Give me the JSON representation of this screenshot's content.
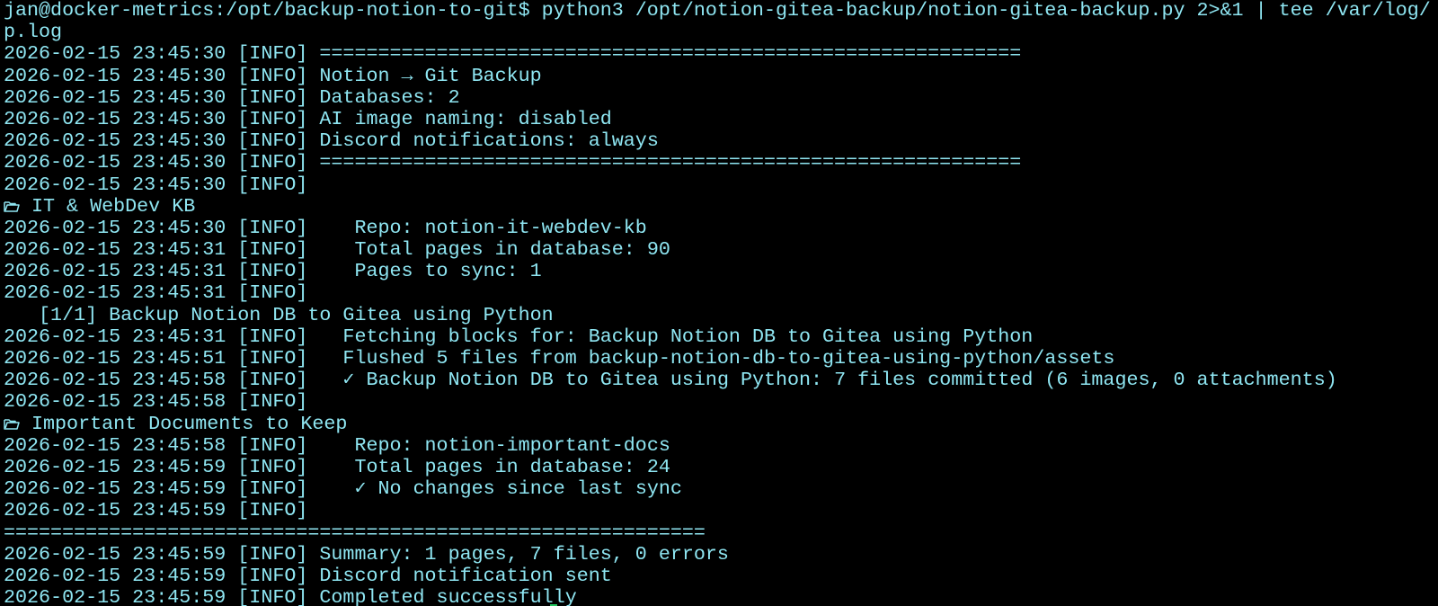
{
  "terminal": {
    "prompt_line": "jan@docker-metrics:/opt/backup-notion-to-git$ python3 /opt/notion-gitea-backup/notion-gitea-backup.py 2>&1 | tee /var/log/",
    "prompt_wrap": "p.log",
    "colors": {
      "background": "#000000",
      "text": "#8fe6f2",
      "cursor": "#22c55e"
    },
    "log": [
      {
        "ts": "2026-02-15 23:45:30",
        "level": "[INFO]",
        "msg": " ============================================================"
      },
      {
        "ts": "2026-02-15 23:45:30",
        "level": "[INFO]",
        "msg": " Notion → Git Backup"
      },
      {
        "ts": "2026-02-15 23:45:30",
        "level": "[INFO]",
        "msg": " Databases: 2"
      },
      {
        "ts": "2026-02-15 23:45:30",
        "level": "[INFO]",
        "msg": " AI image naming: disabled"
      },
      {
        "ts": "2026-02-15 23:45:30",
        "level": "[INFO]",
        "msg": " Discord notifications: always"
      },
      {
        "ts": "2026-02-15 23:45:30",
        "level": "[INFO]",
        "msg": " ============================================================"
      },
      {
        "ts": "2026-02-15 23:45:30",
        "level": "[INFO]",
        "msg": ""
      }
    ],
    "db1": {
      "icon": "folder-icon",
      "title": " IT & WebDev KB",
      "log": [
        {
          "ts": "2026-02-15 23:45:30",
          "level": "[INFO]",
          "msg": "    Repo: notion-it-webdev-kb"
        },
        {
          "ts": "2026-02-15 23:45:31",
          "level": "[INFO]",
          "msg": "    Total pages in database: 90"
        },
        {
          "ts": "2026-02-15 23:45:31",
          "level": "[INFO]",
          "msg": "    Pages to sync: 1"
        },
        {
          "ts": "2026-02-15 23:45:31",
          "level": "[INFO]",
          "msg": ""
        }
      ],
      "page_header": "   [1/1] Backup Notion DB to Gitea using Python",
      "page_log": [
        {
          "ts": "2026-02-15 23:45:31",
          "level": "[INFO]",
          "msg": "   Fetching blocks for: Backup Notion DB to Gitea using Python"
        },
        {
          "ts": "2026-02-15 23:45:51",
          "level": "[INFO]",
          "msg": "   Flushed 5 files from backup-notion-db-to-gitea-using-python/assets"
        },
        {
          "ts": "2026-02-15 23:45:58",
          "level": "[INFO]",
          "msg": "   ✓ Backup Notion DB to Gitea using Python: 7 files committed (6 images, 0 attachments)"
        },
        {
          "ts": "2026-02-15 23:45:58",
          "level": "[INFO]",
          "msg": ""
        }
      ]
    },
    "db2": {
      "icon": "folder-icon",
      "title": " Important Documents to Keep",
      "log": [
        {
          "ts": "2026-02-15 23:45:58",
          "level": "[INFO]",
          "msg": "    Repo: notion-important-docs"
        },
        {
          "ts": "2026-02-15 23:45:59",
          "level": "[INFO]",
          "msg": "    Total pages in database: 24"
        },
        {
          "ts": "2026-02-15 23:45:59",
          "level": "[INFO]",
          "msg": "    ✓ No changes since last sync"
        },
        {
          "ts": "2026-02-15 23:45:59",
          "level": "[INFO]",
          "msg": ""
        }
      ]
    },
    "separator": "============================================================",
    "summary_log": [
      {
        "ts": "2026-02-15 23:45:59",
        "level": "[INFO]",
        "msg": " Summary: 1 pages, 7 files, 0 errors"
      },
      {
        "ts": "2026-02-15 23:45:59",
        "level": "[INFO]",
        "msg": " Discord notification sent"
      },
      {
        "ts": "2026-02-15 23:45:59",
        "level": "[INFO]",
        "msg": " Completed successfully"
      }
    ]
  }
}
